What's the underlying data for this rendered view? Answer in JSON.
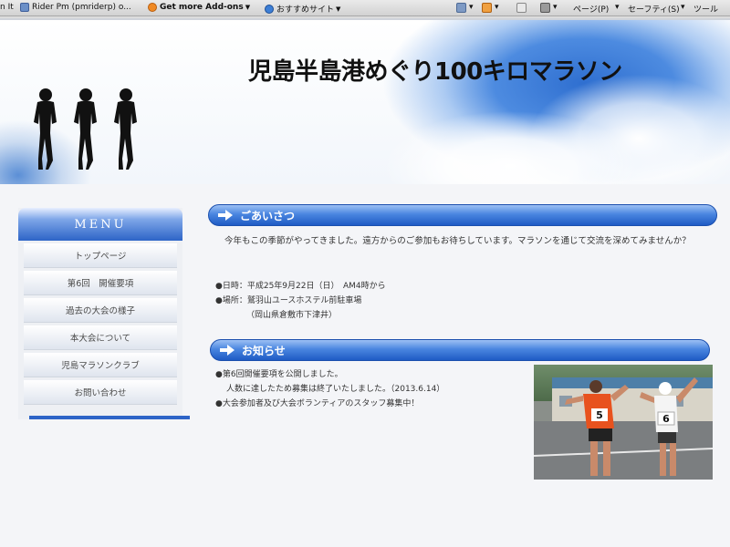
{
  "toolbar": {
    "tab1": "n It",
    "tab2": "Rider Pm (pmriderp) o...",
    "addons": "Get more Add-ons",
    "recommended": "おすすめサイト",
    "page_menu": "ページ(P)",
    "safety_menu": "セーフティ(S)",
    "tools_menu": "ツール"
  },
  "header": {
    "site_title": "児島半島港めぐり100キロマラソン"
  },
  "menu": {
    "title": "MENU",
    "items": [
      {
        "label": "トップページ"
      },
      {
        "label": "第6回　開催要項"
      },
      {
        "label": "過去の大会の様子"
      },
      {
        "label": "本大会について"
      },
      {
        "label": "児島マラソンクラブ"
      },
      {
        "label": "お問い合わせ"
      }
    ]
  },
  "greeting": {
    "title": "ごあいさつ",
    "body": "今年もこの季節がやってきました。遠方からのご参加もお待ちしています。マラソンを通じて交流を深めてみませんか？",
    "date": "●日時：平成25年9月22日（日）　AM4時から",
    "place": "●場所：鷲羽山ユースホステル前駐車場",
    "place_sub": "（岡山県倉敷市下津井）"
  },
  "news": {
    "title": "お知らせ",
    "items": [
      "●第6回開催要項を公開しました。",
      "人数に達したため募集は終了いたしました。（2013.6.14）",
      "●大会参加者及び大会ボランティアのスタッフ募集中！"
    ],
    "photo": {
      "bib_left": "5",
      "bib_right": "6"
    }
  },
  "colors": {
    "accent_blue": "#2d64c7",
    "section_head": "#4a86e0",
    "runner_shirt_left": "#e8521e"
  }
}
